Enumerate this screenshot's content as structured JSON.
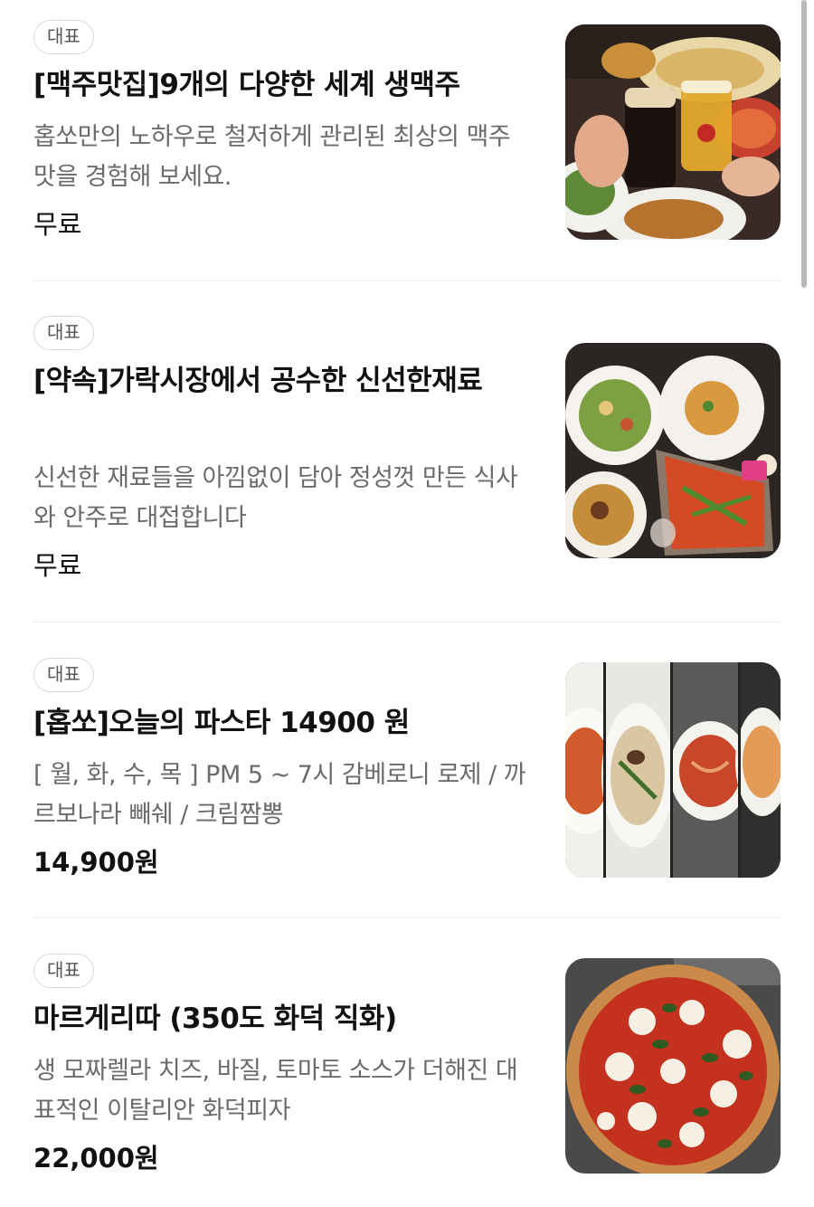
{
  "menu": {
    "items": [
      {
        "badge": "대표",
        "title": "[맥주맛집]9개의 다양한 세계 생맥주",
        "description": "홉쏘만의 노하우로 철저하게 관리된 최상의 맥주맛을 경험해 보세요.",
        "price": "무료",
        "image": "beer-and-food-photo"
      },
      {
        "badge": "대표",
        "title": "[약속]가락시장에서 공수한 신선한재료",
        "description": "신선한 재료들을 아낌없이 담아 정성껏 만든 식사와 안주로 대접합니다",
        "price": "무료",
        "image": "food-table-spread-photo"
      },
      {
        "badge": "대표",
        "title": "[홉쏘]오늘의 파스타 14900 원",
        "description": "[ 월, 화, 수, 목 ] PM 5 ~ 7시 감베로니 로제 / 까르보나라 빼쉐 / 크림짬뽕",
        "price": "14,900원",
        "image": "pasta-dishes-photo"
      },
      {
        "badge": "대표",
        "title": "마르게리따 (350도 화덕 직화)",
        "description": "생 모짜렐라 치즈, 바질, 토마토 소스가 더해진 대표적인 이탈리안 화덕피자",
        "price": "22,000원",
        "image": "margherita-pizza-photo"
      }
    ]
  }
}
